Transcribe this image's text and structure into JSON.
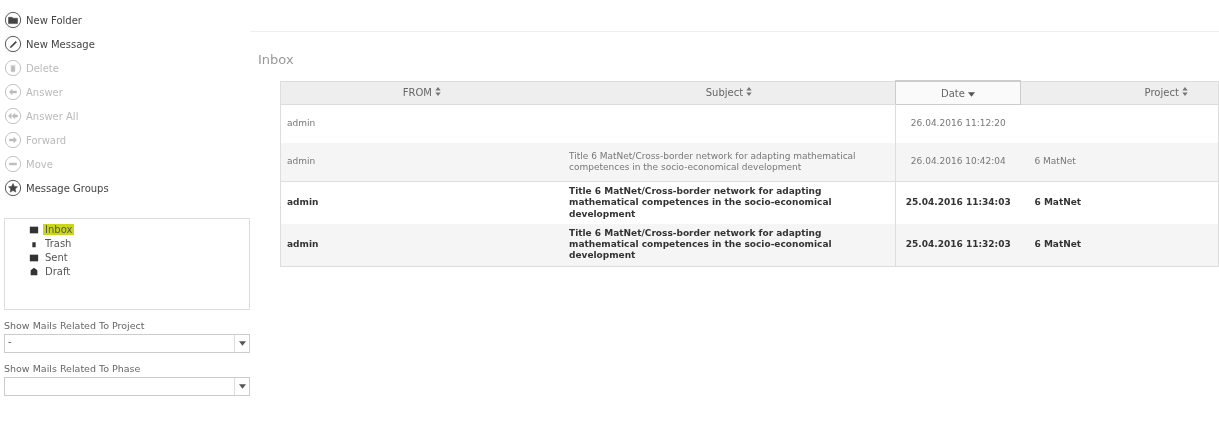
{
  "actions": [
    {
      "label": "New Folder",
      "disabled": false
    },
    {
      "label": "New Message",
      "disabled": false
    },
    {
      "label": "Delete",
      "disabled": true
    },
    {
      "label": "Answer",
      "disabled": true
    },
    {
      "label": "Answer All",
      "disabled": true
    },
    {
      "label": "Forward",
      "disabled": true
    },
    {
      "label": "Move",
      "disabled": true
    },
    {
      "label": "Message Groups",
      "disabled": false
    }
  ],
  "folders": [
    {
      "label": "Inbox",
      "selected": true
    },
    {
      "label": "Trash",
      "selected": false
    },
    {
      "label": "Sent",
      "selected": false
    },
    {
      "label": "Draft",
      "selected": false
    }
  ],
  "filters": [
    {
      "label": "Show Mails Related To Project",
      "value": "-"
    },
    {
      "label": "Show Mails Related To Phase"
    }
  ],
  "title": "Inbox",
  "table": {
    "columns": [
      {
        "label": "FROM",
        "selected": false
      },
      {
        "label": "Subject",
        "selected": false
      },
      {
        "label": "Date",
        "selected": true
      },
      {
        "label": "Project",
        "selected": false
      }
    ],
    "rows": [
      {
        "unread": false,
        "cells": [
          "admin",
          "",
          "26.04.2016 11:12:20",
          ""
        ]
      },
      {
        "unread": false,
        "cells": [
          "admin",
          "Title 6 MatNet/Cross-border network for adapting mathematical competences in the socio-economical development",
          "26.04.2016 10:42:04",
          "6 MatNet"
        ]
      },
      {
        "unread": true,
        "cells": [
          "admin",
          "Title 6 MatNet/Cross-border network for adapting mathematical competences in the socio-economical development",
          "25.04.2016 11:34:03",
          "6 MatNet"
        ]
      },
      {
        "unread": true,
        "cells": [
          "admin",
          "Title 6 MatNet/Cross-border network for adapting mathematical competences in the socio-economical development",
          "25.04.2016 11:32:03",
          "6 MatNet"
        ]
      }
    ]
  }
}
